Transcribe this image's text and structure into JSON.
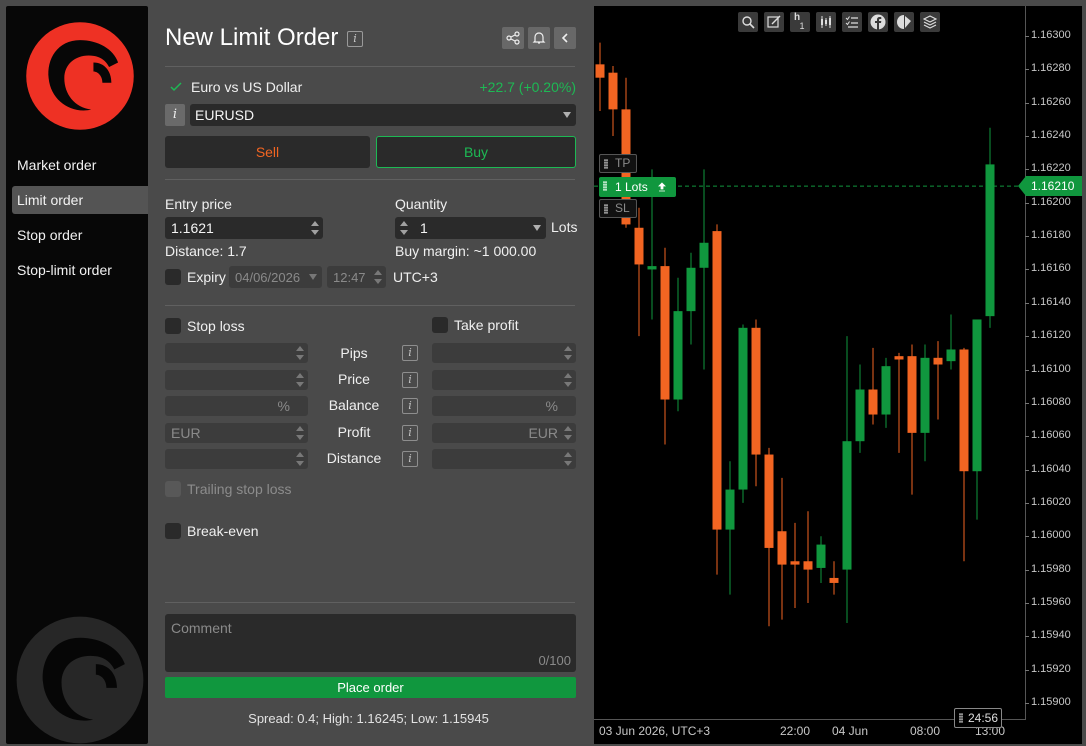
{
  "sidebar": {
    "items": [
      {
        "label": "Market order",
        "active": false
      },
      {
        "label": "Limit order",
        "active": true
      },
      {
        "label": "Stop order",
        "active": false
      },
      {
        "label": "Stop-limit order",
        "active": false
      }
    ]
  },
  "header": {
    "title": "New Limit Order",
    "info_glyph": "i",
    "icons": [
      "share-icon",
      "bell-icon",
      "chevron-left-icon"
    ]
  },
  "instrument": {
    "name": "Euro vs US Dollar",
    "change": "+22.7 (+0.20%)",
    "symbol": "EURUSD",
    "info_glyph": "i"
  },
  "sides": {
    "sell": "Sell",
    "buy": "Buy",
    "selected": "Buy"
  },
  "entry": {
    "label": "Entry price",
    "value": "1.1621",
    "distance": "Distance: 1.7"
  },
  "quantity": {
    "label": "Quantity",
    "value": "1",
    "unit": "Lots",
    "margin": "Buy margin: ~1 000.00"
  },
  "expiry": {
    "label": "Expiry",
    "date": "04/06/2026",
    "time": "12:47",
    "tz": "UTC+3",
    "checked": false
  },
  "protection": {
    "stop_loss": "Stop loss",
    "take_profit": "Take profit",
    "rows": [
      {
        "label": "Pips",
        "left": "",
        "right": ""
      },
      {
        "label": "Price",
        "left": "",
        "right": ""
      },
      {
        "label": "Balance",
        "left": "%",
        "right": "%"
      },
      {
        "label": "Profit",
        "left": "EUR",
        "right": "EUR"
      },
      {
        "label": "Distance",
        "left": "",
        "right": ""
      }
    ],
    "trailing": "Trailing stop loss",
    "break_even": "Break-even"
  },
  "comment": {
    "placeholder": "Comment",
    "counter": "0/100"
  },
  "place_order": "Place order",
  "spread_info": "Spread: 0.4; High: 1.16245; Low: 1.15945",
  "chart": {
    "toolbar": [
      "zoom-icon",
      "edit-chart-icon",
      "timeframe-h1",
      "candles-icon",
      "indicators-list-icon",
      "facebook-icon",
      "sentiment-icon",
      "layers-icon"
    ],
    "timeframe_label": "h",
    "timeframe_value": "1",
    "lots_tag": "1 Lots",
    "tp_tag": "TP",
    "sl_tag": "SL",
    "price_tag": "1.16210",
    "timer": "24:56",
    "up_color": "#10973e",
    "down_color": "#f26522"
  },
  "chart_data": {
    "type": "candlestick",
    "symbol": "EURUSD",
    "interval": "h1",
    "ylim": [
      1.15895,
      1.16315
    ],
    "y_ticks": [
      "1.16300",
      "1.16280",
      "1.16260",
      "1.16240",
      "1.16220",
      "1.16200",
      "1.16180",
      "1.16160",
      "1.16140",
      "1.16120",
      "1.16100",
      "1.16080",
      "1.16060",
      "1.16040",
      "1.16020",
      "1.16000",
      "1.15980",
      "1.15960",
      "1.15940",
      "1.15920",
      "1.15900"
    ],
    "x_ticks": [
      {
        "label": "03 Jun 2026, UTC+3",
        "index": 0
      },
      {
        "label": "22:00",
        "index": 15
      },
      {
        "label": "04 Jun",
        "index": 19
      },
      {
        "label": "08:00",
        "index": 25
      },
      {
        "label": "13:00",
        "index": 30
      }
    ],
    "candles": [
      {
        "o": 1.16283,
        "h": 1.16296,
        "l": 1.16255,
        "c": 1.16275
      },
      {
        "o": 1.16278,
        "h": 1.16282,
        "l": 1.1624,
        "c": 1.16256
      },
      {
        "o": 1.16256,
        "h": 1.16275,
        "l": 1.16185,
        "c": 1.16187
      },
      {
        "o": 1.16185,
        "h": 1.16197,
        "l": 1.1612,
        "c": 1.16163
      },
      {
        "o": 1.1616,
        "h": 1.1622,
        "l": 1.1613,
        "c": 1.16162
      },
      {
        "o": 1.16162,
        "h": 1.16173,
        "l": 1.16055,
        "c": 1.16082
      },
      {
        "o": 1.16082,
        "h": 1.16155,
        "l": 1.16075,
        "c": 1.16135
      },
      {
        "o": 1.16135,
        "h": 1.1617,
        "l": 1.16115,
        "c": 1.16161
      },
      {
        "o": 1.16161,
        "h": 1.1622,
        "l": 1.161,
        "c": 1.16176
      },
      {
        "o": 1.16183,
        "h": 1.16187,
        "l": 1.15977,
        "c": 1.16004
      },
      {
        "o": 1.16004,
        "h": 1.16045,
        "l": 1.15965,
        "c": 1.16028
      },
      {
        "o": 1.16028,
        "h": 1.16127,
        "l": 1.1602,
        "c": 1.16125
      },
      {
        "o": 1.16125,
        "h": 1.1613,
        "l": 1.1603,
        "c": 1.16049
      },
      {
        "o": 1.16049,
        "h": 1.16053,
        "l": 1.15946,
        "c": 1.15993
      },
      {
        "o": 1.16003,
        "h": 1.16035,
        "l": 1.1595,
        "c": 1.15983
      },
      {
        "o": 1.15985,
        "h": 1.16008,
        "l": 1.15957,
        "c": 1.15983
      },
      {
        "o": 1.15985,
        "h": 1.16015,
        "l": 1.1596,
        "c": 1.1598
      },
      {
        "o": 1.15981,
        "h": 1.16,
        "l": 1.15972,
        "c": 1.15995
      },
      {
        "o": 1.15975,
        "h": 1.15985,
        "l": 1.15965,
        "c": 1.15972
      },
      {
        "o": 1.1598,
        "h": 1.1612,
        "l": 1.15948,
        "c": 1.16057
      },
      {
        "o": 1.16057,
        "h": 1.16103,
        "l": 1.1605,
        "c": 1.16088
      },
      {
        "o": 1.16088,
        "h": 1.16113,
        "l": 1.16067,
        "c": 1.16073
      },
      {
        "o": 1.16073,
        "h": 1.16107,
        "l": 1.16065,
        "c": 1.16102
      },
      {
        "o": 1.16108,
        "h": 1.1611,
        "l": 1.1605,
        "c": 1.16106
      },
      {
        "o": 1.16108,
        "h": 1.16115,
        "l": 1.16025,
        "c": 1.16062
      },
      {
        "o": 1.16062,
        "h": 1.16115,
        "l": 1.16045,
        "c": 1.16107
      },
      {
        "o": 1.16107,
        "h": 1.16117,
        "l": 1.1607,
        "c": 1.16103
      },
      {
        "o": 1.16105,
        "h": 1.16133,
        "l": 1.161,
        "c": 1.16112
      },
      {
        "o": 1.16112,
        "h": 1.16113,
        "l": 1.15985,
        "c": 1.16039
      },
      {
        "o": 1.16039,
        "h": 1.16125,
        "l": 1.1601,
        "c": 1.1613
      },
      {
        "o": 1.16132,
        "h": 1.16245,
        "l": 1.16125,
        "c": 1.16223
      }
    ]
  }
}
